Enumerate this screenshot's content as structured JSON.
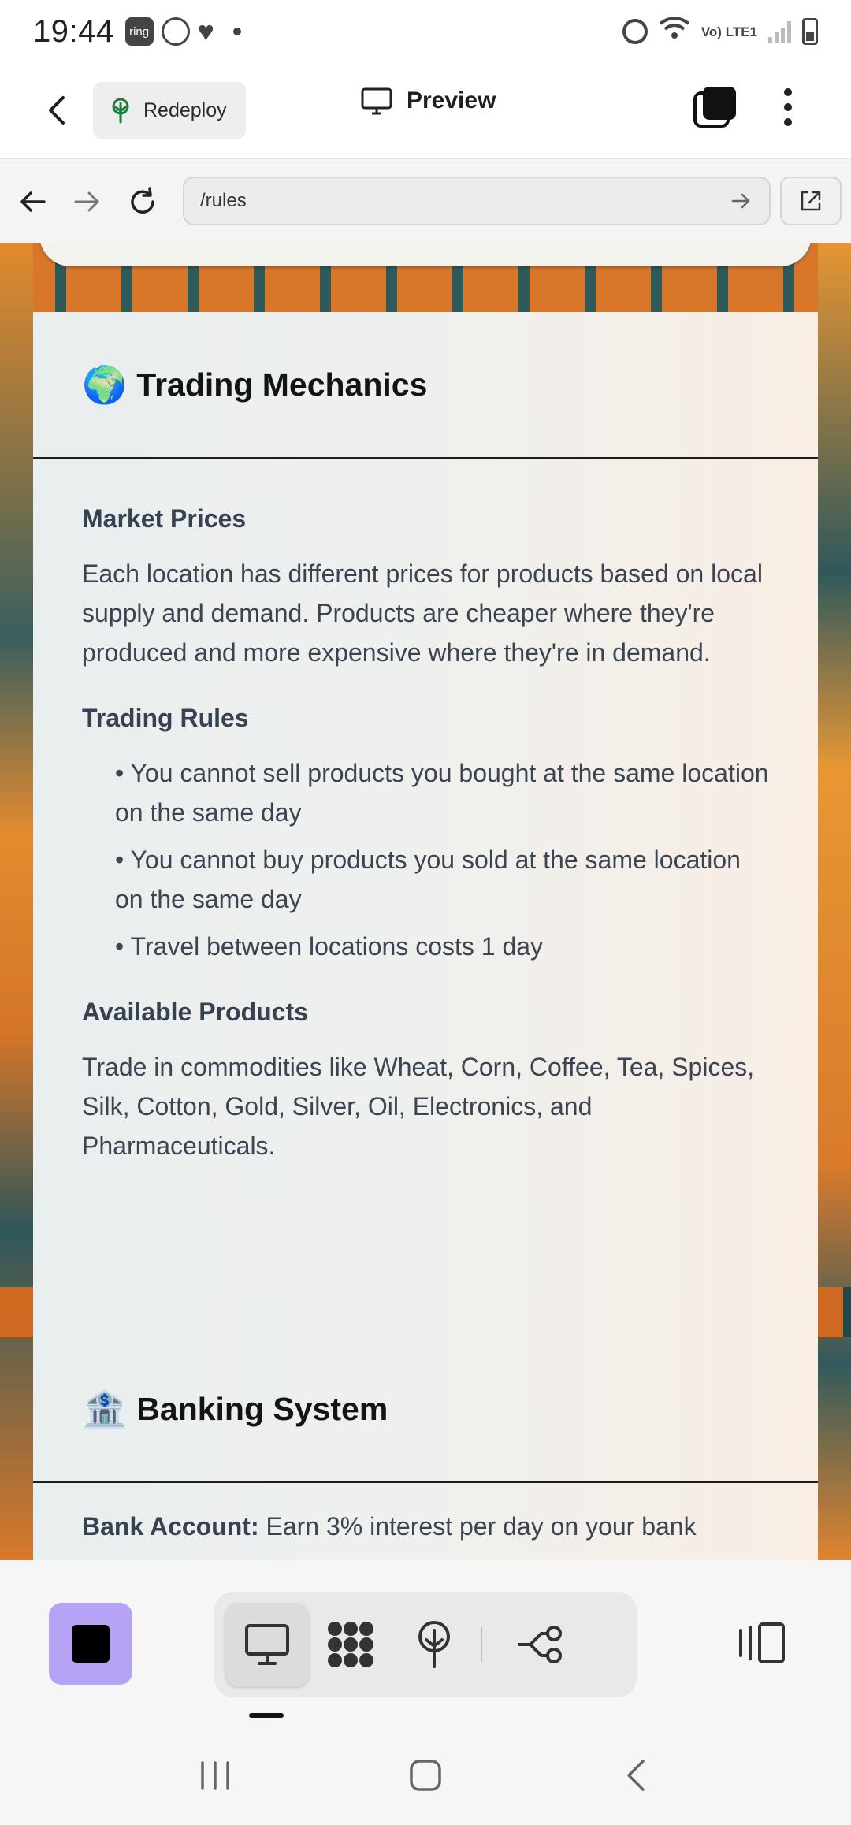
{
  "status_bar": {
    "time": "19:44",
    "badge_text": "ring",
    "network_label": "Vo) LTE1",
    "wifi_label": "6"
  },
  "header": {
    "redeploy_label": "Redeploy",
    "preview_label": "Preview"
  },
  "url_bar": {
    "url": "/rules"
  },
  "sections": {
    "trading": {
      "emoji": "🌍",
      "title": "Trading Mechanics",
      "market_title": "Market Prices",
      "market_text": "Each location has different prices for products based on local supply and demand. Products are cheaper where they're produced and more expensive where they're in demand.",
      "rules_title": "Trading Rules",
      "rules": [
        "• You cannot sell products you bought at the same location on the same day",
        "• You cannot buy products you sold at the same location on the same day",
        "• Travel between locations costs 1 day"
      ],
      "products_title": "Available Products",
      "products_text": "Trade in commodities like Wheat, Corn, Coffee, Tea, Spices, Silk, Cotton, Gold, Silver, Oil, Electronics, and Pharmaceuticals."
    },
    "banking": {
      "emoji": "🏦",
      "title": "Banking System",
      "account_label": "Bank Account:",
      "account_text": " Earn 3% interest per day on your bank"
    }
  },
  "toolbar": {
    "icons": [
      "stop-icon",
      "desktop-icon",
      "apps-icon",
      "deploy-icon",
      "workflow-icon",
      "side-panel-icon"
    ]
  },
  "colors": {
    "accent": "#b7a3f5",
    "background_orange": "#d8772a",
    "background_teal": "#2f5a5a"
  }
}
